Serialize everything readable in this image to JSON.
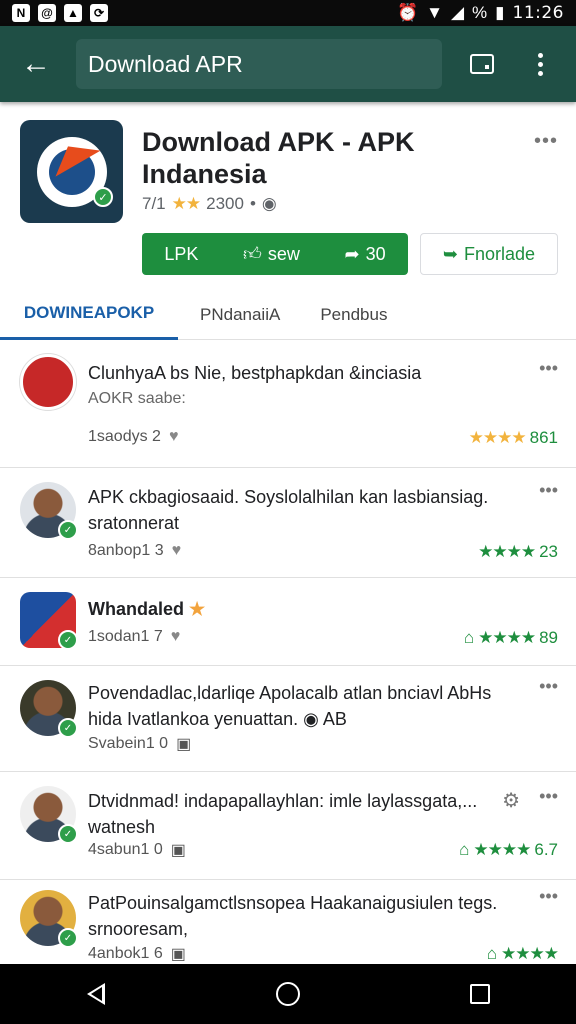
{
  "status_bar": {
    "time": "11:26",
    "battery_text": "%"
  },
  "toolbar": {
    "search_text": "Download APR"
  },
  "app": {
    "title": "Download APK - APK Indanesia",
    "meta_rating": "7/1",
    "meta_stars": "★★",
    "meta_count": "2300",
    "buttons": {
      "primary": "LPK",
      "like": "sew",
      "share": "30",
      "outline": "Fnorlade"
    }
  },
  "tabs": [
    {
      "label": "DOWINEAPOKP"
    },
    {
      "label": "PNdanaiiA"
    },
    {
      "label": "Pendbus"
    }
  ],
  "reviews": [
    {
      "title": "ClunhyaA bs Nie, bestphapkdan &inciasia",
      "sub": "AOKR saabe:",
      "meta": "1saodys 2",
      "stars": "★★★★",
      "rating": "861"
    },
    {
      "title": "APK ckbagiosaaid. Soyslolalhilan kan lasbiansiag. sratonnerat",
      "sub": "",
      "meta": "8anbop1 3",
      "stars": "★★★★",
      "rating": "23"
    },
    {
      "title": "Whandaled",
      "sub": "",
      "meta": "1sodan1 7",
      "stars": "★★★★",
      "rating": "89"
    },
    {
      "title": "Povendadlac,ldarliqe Apolacalb atlan bnciavl AbHs hida Ivatlankoa yenuattan.",
      "sub": "AB",
      "meta": "Svabein1 0",
      "stars": "",
      "rating": ""
    },
    {
      "title": "Dtvidnmad! indapapallayhlan: imle laylassgata,... watnesh",
      "sub": "",
      "meta": "4sabun1 0",
      "stars": "★★★★",
      "rating": "6.7"
    },
    {
      "title": "PatPouinsalgamctlsnsopea Haakanaigusiulen tegs. srnooresam,",
      "sub": "",
      "meta": "4anbok1 6",
      "stars": "★★★★",
      "rating": ""
    }
  ]
}
